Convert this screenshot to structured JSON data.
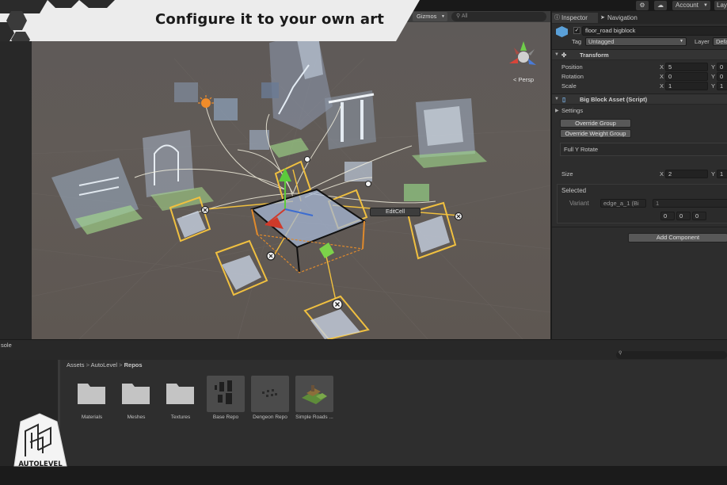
{
  "banner": {
    "title": "Configure it to your own art"
  },
  "toolbar": {
    "account": "Account",
    "layers": "Lay"
  },
  "scene_toolbar": {
    "gizmos": "Gizmos",
    "search_placeholder": "All"
  },
  "scene": {
    "persp_label": "< Persp",
    "edit_cell_label": "EditCell"
  },
  "inspector": {
    "tabs": {
      "inspector": "Inspector",
      "navigation": "Navigation"
    },
    "object_name": "floor_road bigblock",
    "tag_label": "Tag",
    "tag_value": "Untagged",
    "layer_label": "Layer",
    "layer_value": "Defa",
    "transform": {
      "title": "Transform",
      "position_label": "Position",
      "position_x": "5",
      "position_y": "0",
      "rotation_label": "Rotation",
      "rotation_x": "0",
      "rotation_y": "0",
      "scale_label": "Scale",
      "scale_x": "1",
      "scale_y": "1",
      "x_axis": "X",
      "y_axis": "Y"
    },
    "script": {
      "title": "Big Block Asset (Script)",
      "settings_label": "Settings",
      "override_group": "Override Group",
      "override_weight_group": "Override Weight Group",
      "full_y_rotate": "Full Y Rotate",
      "size_label": "Size",
      "size_x": "2",
      "size_y": "1",
      "selected_label": "Selected",
      "variant_label": "Variant",
      "variant_value": "edge_a_1 (Bi",
      "variant_number": "1",
      "vec_a": "0",
      "vec_b": "0",
      "vec_c": "0"
    },
    "add_component": "Add Component"
  },
  "console": {
    "label": "sole"
  },
  "project": {
    "breadcrumb": {
      "assets": "Assets",
      "autolevel": "AutoLevel",
      "repos": "Repos",
      "separator": ">"
    },
    "assets": [
      {
        "label": "Materials",
        "kind": "folder"
      },
      {
        "label": "Meshes",
        "kind": "folder"
      },
      {
        "label": "Textures",
        "kind": "folder"
      },
      {
        "label": "Base Repo",
        "kind": "prefab"
      },
      {
        "label": "Dengeon Repo",
        "kind": "prefab"
      },
      {
        "label": "Simple Roads ...",
        "kind": "prefab"
      }
    ]
  },
  "logo": {
    "text": "AUTOLEVEL"
  }
}
